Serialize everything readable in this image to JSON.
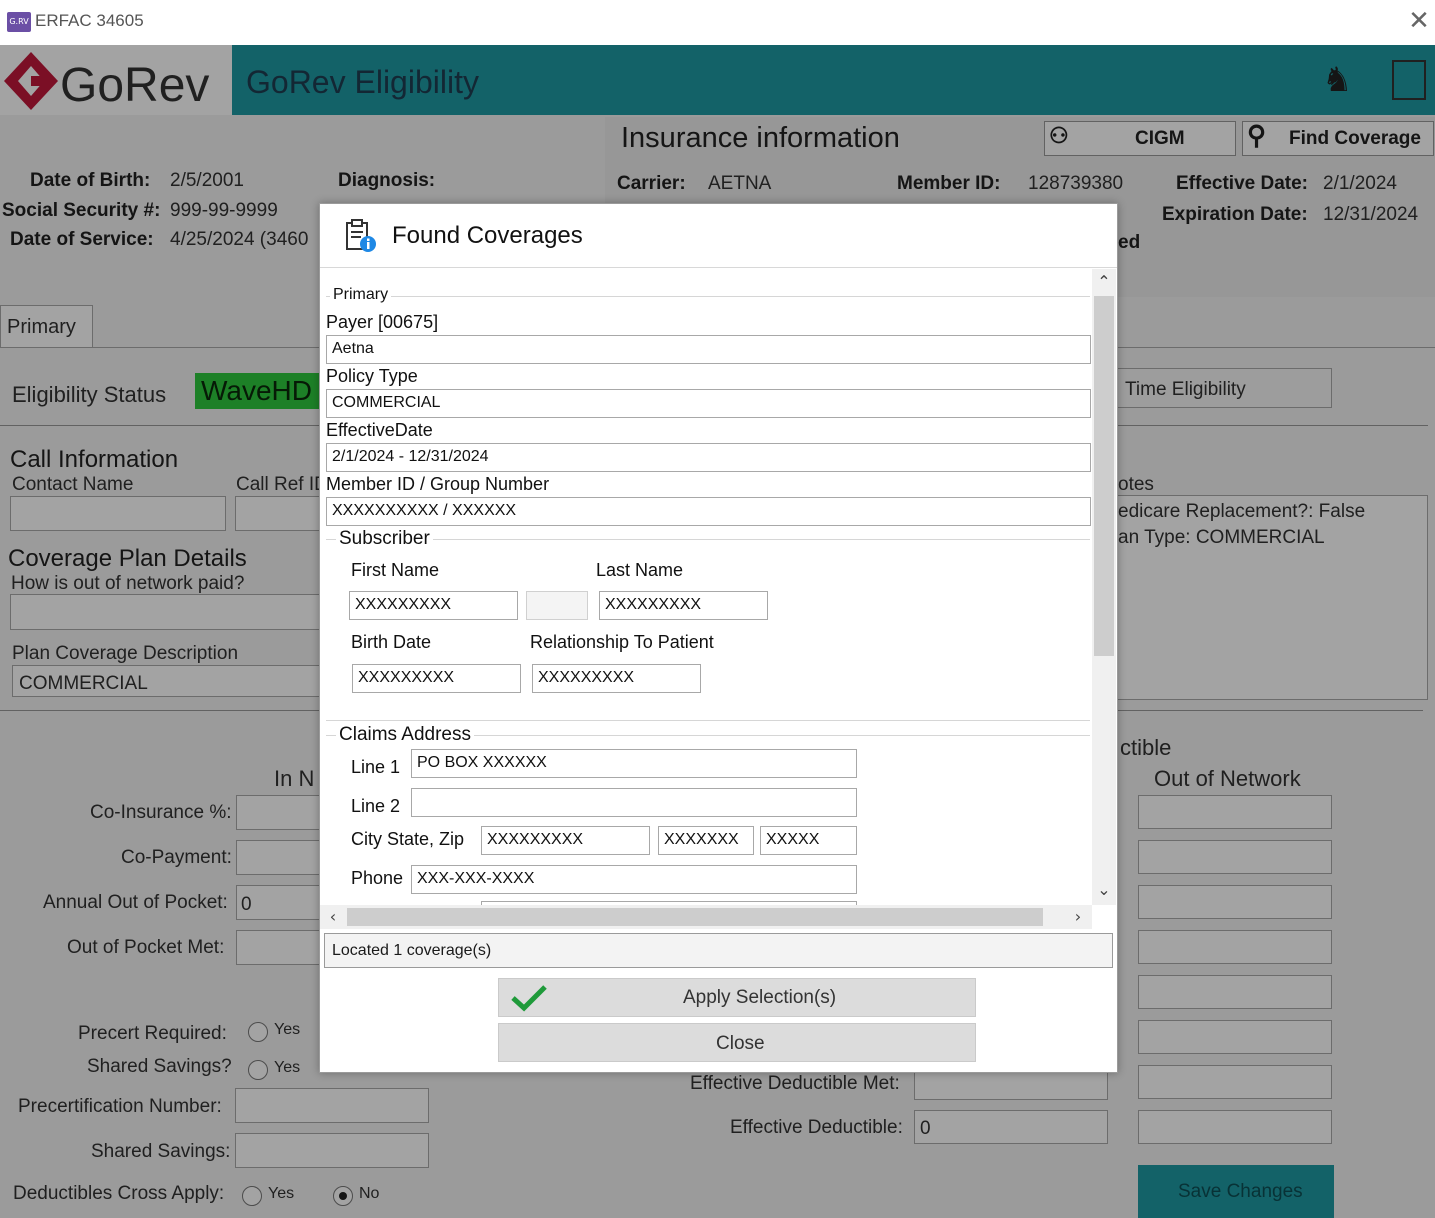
{
  "window": {
    "title": "ERFAC 34605",
    "app_icon_text": "G.RV"
  },
  "header": {
    "logo_text": "GoRev",
    "app_title": "GoRev Eligibility"
  },
  "colors": {
    "teal": "#1f9aa3",
    "logo_red": "#c0183a",
    "status_green": "#2ec83d",
    "save_button": "#1f9aa3"
  },
  "patient": {
    "dob_label": "Date of Birth:",
    "dob": "2/5/2001",
    "ssn_label": "Social Security #:",
    "ssn": "999-99-9999",
    "dos_label": "Date of Service:",
    "dos": "4/25/2024 (3460",
    "diagnosis_label": "Diagnosis:"
  },
  "insurance": {
    "title": "Insurance information",
    "cigm_label": "CIGM",
    "find_label": "Find Coverage",
    "carrier_label": "Carrier:",
    "carrier": "AETNA",
    "member_label": "Member ID:",
    "member": "128739380",
    "effective_label": "Effective Date:",
    "effective": "2/1/2024",
    "expiration_label": "Expiration Date:",
    "expiration": "12/31/2024",
    "partial": "ed"
  },
  "tabs": {
    "primary": "Primary"
  },
  "eligibility": {
    "label": "Eligibility Status",
    "value": "WaveHD",
    "right_tab": "Time Eligibility"
  },
  "call_info": {
    "title": "Call Information",
    "contact": "Contact Name",
    "callref": "Call Ref ID"
  },
  "notes": {
    "label": "otes",
    "line1": "edicare Replacement?: False",
    "line2": "an Type: COMMERCIAL"
  },
  "coverage_plan": {
    "title": "Coverage Plan Details",
    "oon_q": "How is out of network paid?",
    "desc_label": "Plan Coverage Description",
    "desc_value": "COMMERCIAL"
  },
  "benefits": {
    "in_network": "In N",
    "deductible_partial": "ctible",
    "out_network": "Out of Network",
    "coins": "Co-Insurance %:",
    "copay": "Co-Payment:",
    "annual_oop": "Annual Out of Pocket:",
    "annual_oop_val": "0",
    "oop_met": "Out of Pocket Met:",
    "precert_req": "Precert Required:",
    "shared_q": "Shared Savings?",
    "yes": "Yes",
    "no": "No",
    "precert_num": "Precertification Number:",
    "shared": "Shared Savings:",
    "ded_cross": "Deductibles Cross Apply:",
    "eff_ded_met": "Effective Deductible Met:",
    "eff_ded": "Effective Deductible:",
    "eff_ded_val": "0",
    "save": "Save Changes"
  },
  "dialog": {
    "title": "Found Coverages",
    "section": "Primary",
    "payer_label": "Payer [00675]",
    "payer": "Aetna",
    "policy_label": "Policy Type",
    "policy": "COMMERCIAL",
    "eff_label": "EffectiveDate",
    "eff": "2/1/2024 - 12/31/2024",
    "member_label": "Member ID  / Group Number",
    "member": "XXXXXXXXXX / XXXXXX",
    "subscriber": {
      "title": "Subscriber",
      "first_label": "First Name",
      "first": "XXXXXXXXX",
      "middle": "",
      "last_label": "Last Name",
      "last": "XXXXXXXXX",
      "birth_label": "Birth Date",
      "birth": "XXXXXXXXX",
      "rel_label": "Relationship To Patient",
      "rel": "XXXXXXXXX"
    },
    "claims": {
      "title": "Claims Address",
      "line1_label": "Line 1",
      "line1": "PO BOX XXXXXX",
      "line2_label": "Line 2",
      "line2": "",
      "city_label": "City State, Zip",
      "city": "XXXXXXXXX",
      "state": "XXXXXXX",
      "zip": "XXXXX",
      "phone_label": "Phone",
      "phone": "XXX-XXX-XXXX"
    },
    "status": "Located 1 coverage(s)",
    "apply": "Apply Selection(s)",
    "close": "Close"
  }
}
